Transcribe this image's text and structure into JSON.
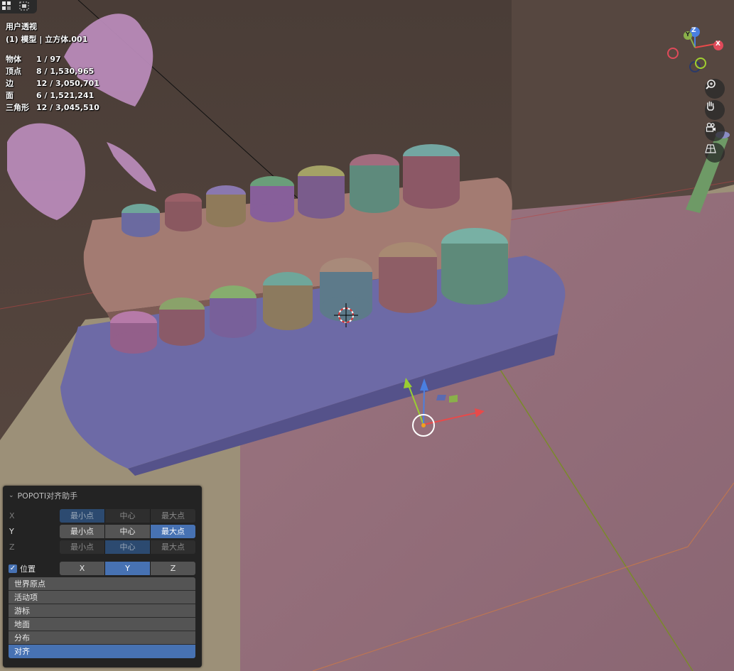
{
  "viewport": {
    "view_title": "用户透视",
    "view_subtitle": "(1) 模型 | 立方体.001",
    "stats": [
      {
        "label": "物体",
        "value": "1 / 97"
      },
      {
        "label": "顶点",
        "value": "8 / 1,530,965"
      },
      {
        "label": "边",
        "value": "12 / 3,050,701"
      },
      {
        "label": "面",
        "value": "6 / 1,521,241"
      },
      {
        "label": "三角形",
        "value": "12 / 3,045,510"
      }
    ]
  },
  "gizmo": {
    "z": "Z",
    "x": "X",
    "y": "Y"
  },
  "nav_icons": [
    "zoom-icon",
    "hand-pan-icon",
    "camera-icon",
    "grid-perspective-icon"
  ],
  "panel": {
    "title": "POPOTI对齐助手",
    "axes": [
      {
        "label": "X",
        "options": [
          "最小点",
          "中心",
          "最大点"
        ],
        "selected": "最小点",
        "enabled": false
      },
      {
        "label": "Y",
        "options": [
          "最小点",
          "中心",
          "最大点"
        ],
        "selected": "最大点",
        "enabled": true
      },
      {
        "label": "Z",
        "options": [
          "最小点",
          "中心",
          "最大点"
        ],
        "selected": "中心",
        "enabled": false
      }
    ],
    "position_label": "位置",
    "position_axes": [
      "X",
      "Y",
      "Z"
    ],
    "position_selected": "Y",
    "actions": [
      "世界原点",
      "活动项",
      "游标",
      "地面",
      "分布",
      "对齐"
    ],
    "action_selected": "对齐"
  },
  "colors": {
    "accent": "#4772b3",
    "panel_bg": "#232323",
    "button_bg": "#545454"
  }
}
